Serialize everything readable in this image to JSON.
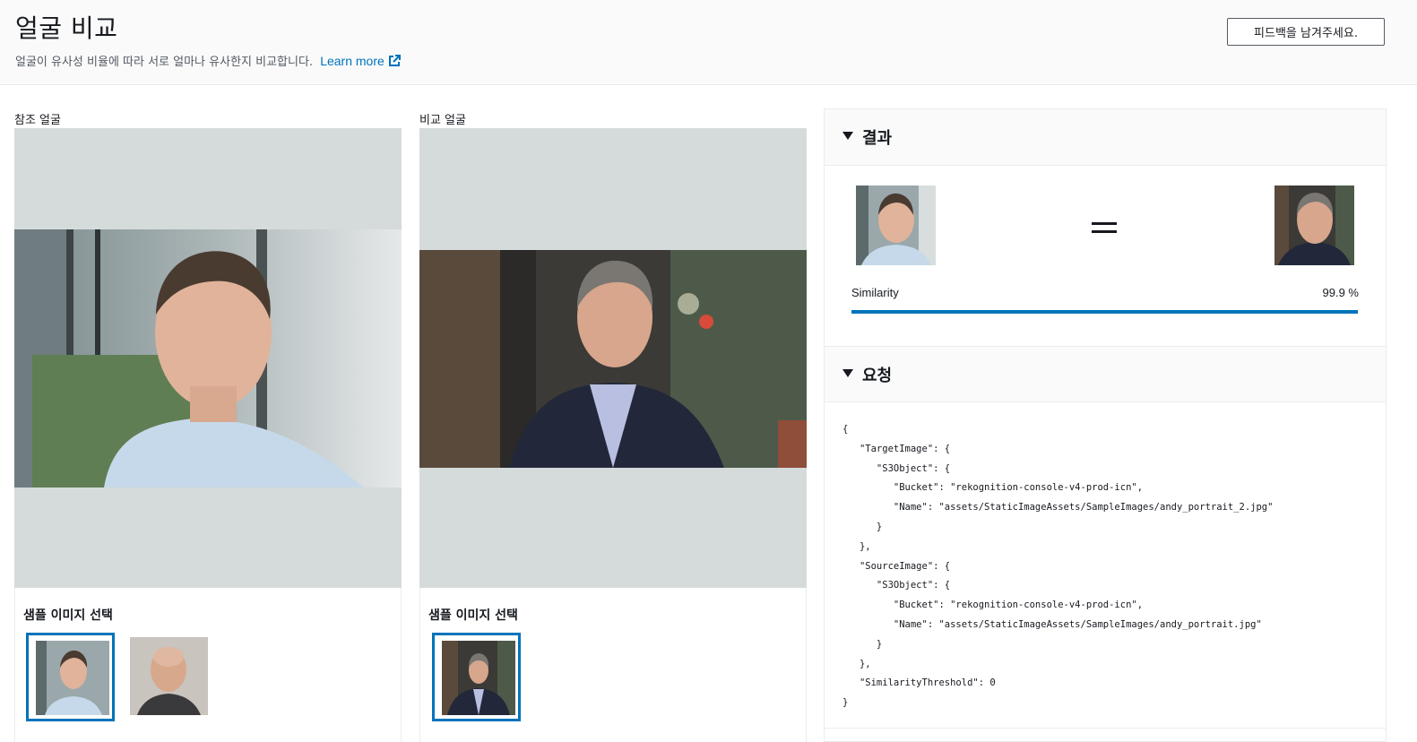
{
  "header": {
    "title": "얼굴 비교",
    "description": "얼굴이 유사성 비율에 따라 서로 얼마나 유사한지 비교합니다.",
    "learn_more": "Learn more",
    "feedback_button": "피드백을 남겨주세요."
  },
  "reference": {
    "label": "참조 얼굴",
    "sample_title": "샘플 이미지 선택"
  },
  "comparison": {
    "label": "비교 얼굴",
    "sample_title": "샘플 이미지 선택"
  },
  "results": {
    "title": "결과",
    "similarity_label": "Similarity",
    "similarity_value": "99.9 %",
    "similarity_fraction": 0.999
  },
  "request": {
    "title": "요청",
    "json": "{\n   \"TargetImage\": {\n      \"S3Object\": {\n         \"Bucket\": \"rekognition-console-v4-prod-icn\",\n         \"Name\": \"assets/StaticImageAssets/SampleImages/andy_portrait_2.jpg\"\n      }\n   },\n   \"SourceImage\": {\n      \"S3Object\": {\n         \"Bucket\": \"rekognition-console-v4-prod-icn\",\n         \"Name\": \"assets/StaticImageAssets/SampleImages/andy_portrait.jpg\"\n      }\n   },\n   \"SimilarityThreshold\": 0\n}"
  },
  "colors": {
    "accent": "#0073bb",
    "frame_bg": "#d5dbdb"
  },
  "icons": {
    "external_link": "external-link-icon",
    "collapse": "caret-down-icon"
  }
}
